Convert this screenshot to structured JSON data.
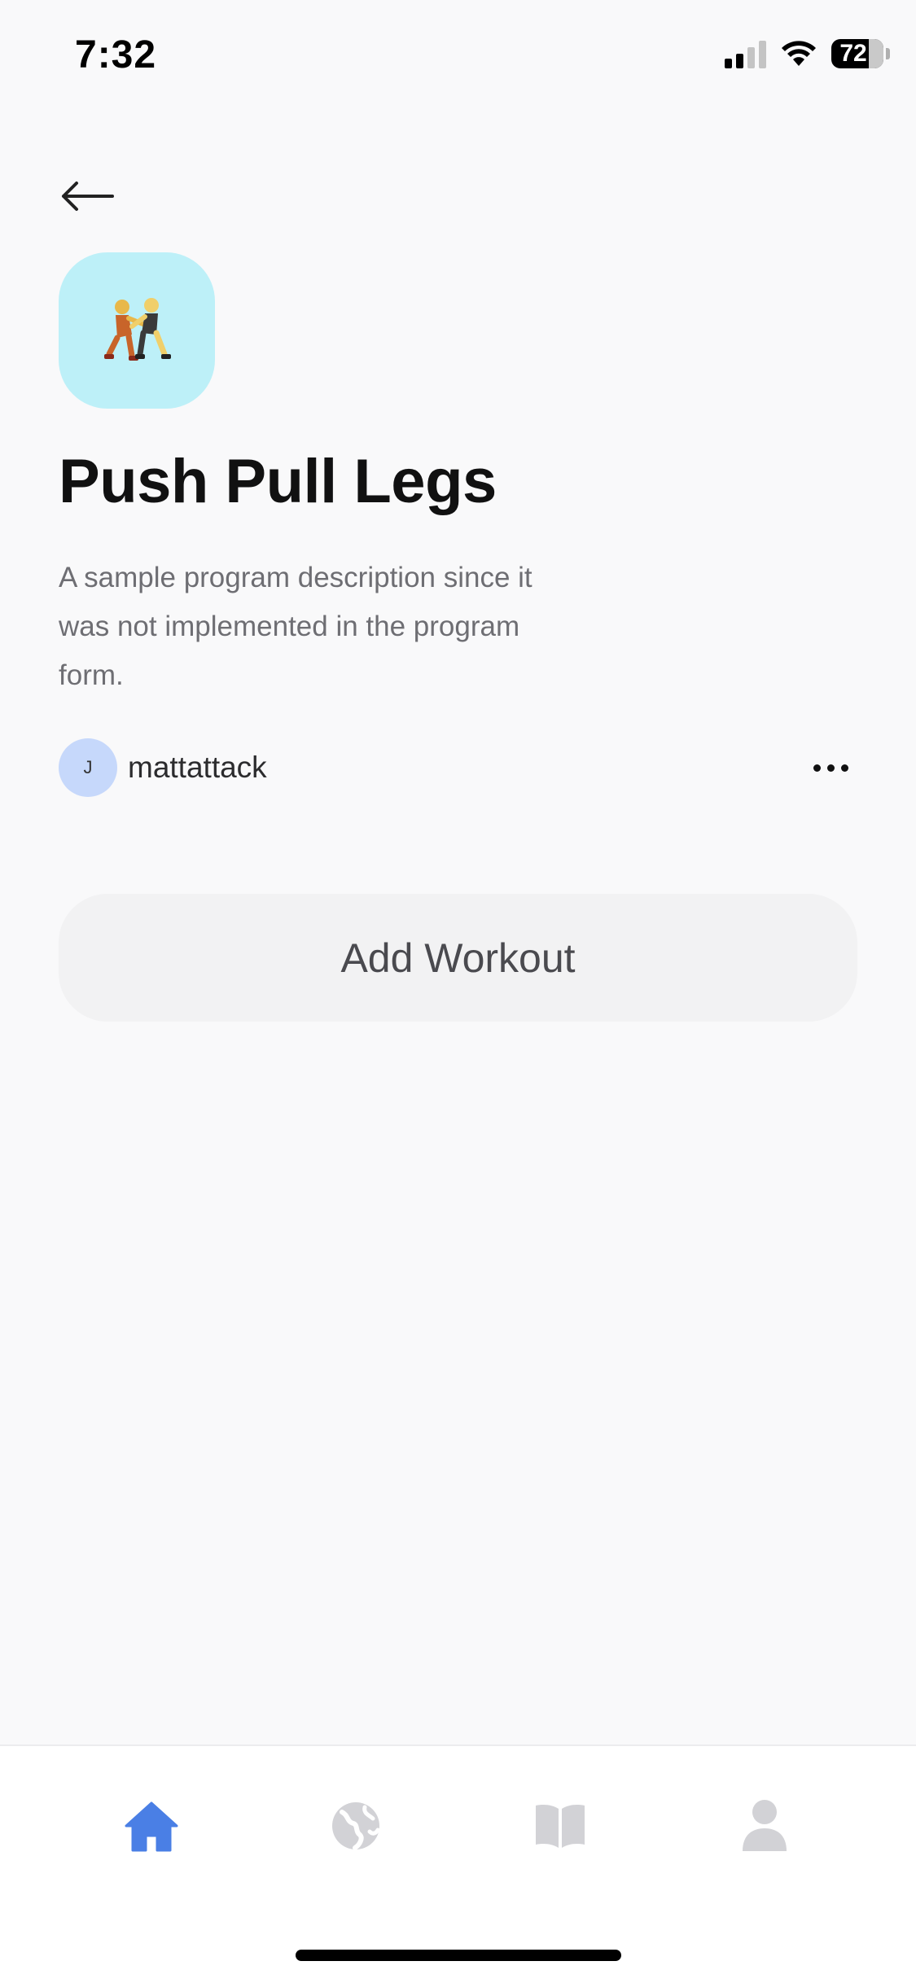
{
  "status_bar": {
    "time": "7:32",
    "battery_percent": "72"
  },
  "program": {
    "icon": "wrestlers-emoji",
    "icon_bg_color": "#bdf0f8",
    "title": "Push Pull Legs",
    "description": "A sample program description since it was not implemented in the program form.",
    "author": {
      "avatar_initial": "J",
      "name": "mattattack"
    }
  },
  "actions": {
    "add_workout_label": "Add Workout"
  },
  "tab_bar": {
    "accent_color": "#4a7fe5",
    "inactive_color": "#d2d2d6",
    "tabs": [
      {
        "icon": "home-icon",
        "active": true
      },
      {
        "icon": "globe-icon",
        "active": false
      },
      {
        "icon": "book-icon",
        "active": false
      },
      {
        "icon": "person-icon",
        "active": false
      }
    ]
  }
}
